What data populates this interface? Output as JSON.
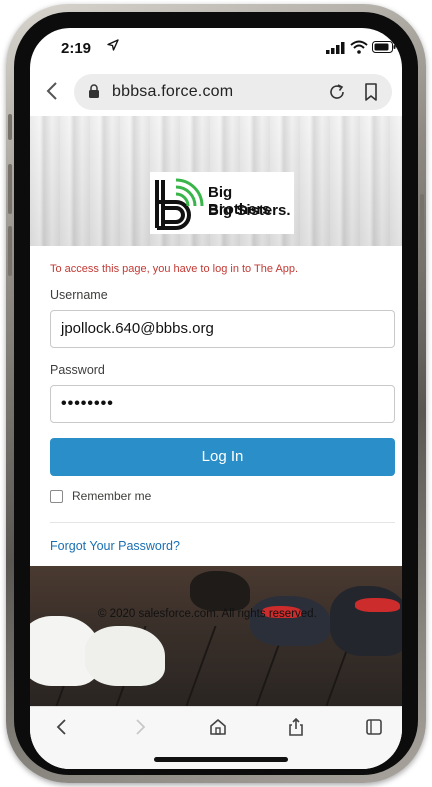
{
  "status_bar": {
    "time": "2:19",
    "icons": [
      "location-arrow-icon",
      "signal-icon",
      "wifi-icon",
      "battery-icon"
    ]
  },
  "browser": {
    "url": "bbbsa.force.com",
    "icons": [
      "back-icon",
      "lock-icon",
      "reload-icon",
      "bookmark-icon"
    ]
  },
  "logo": {
    "line1": "Big Brothers",
    "line2": "Big Sisters."
  },
  "login": {
    "error_message": "To access this page, you have to log in to The App.",
    "username_label": "Username",
    "username_value": "jpollock.640@bbbs.org",
    "password_label": "Password",
    "password_value": "••••••••",
    "login_button": "Log In",
    "remember_me": "Remember me",
    "forgot_password": "Forgot Your Password?"
  },
  "footer": {
    "copyright": "© 2020 salesforce.com. All rights reserved."
  },
  "toolbar": {
    "icons": [
      "back-icon",
      "forward-icon",
      "home-icon",
      "share-icon",
      "tabs-icon"
    ]
  },
  "colors": {
    "error": "#c23934",
    "primary_button": "#2a8fc8",
    "link": "#1a6fb3",
    "logo_green": "#39b54a"
  }
}
